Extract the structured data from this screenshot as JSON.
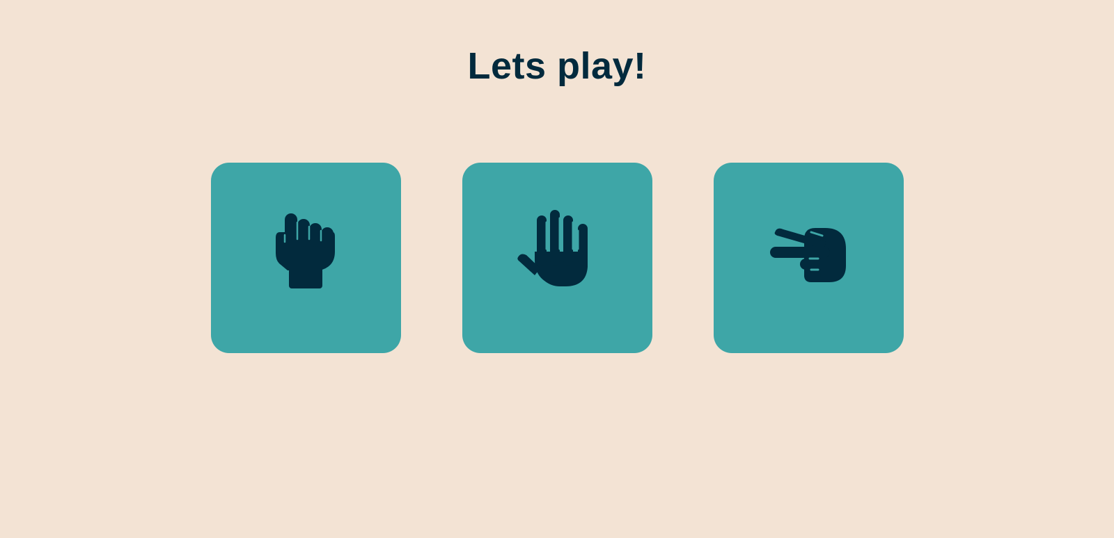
{
  "game": {
    "title": "Lets play!"
  },
  "choices": [
    {
      "id": "rock",
      "icon": "rock-fist-icon"
    },
    {
      "id": "paper",
      "icon": "paper-hand-icon"
    },
    {
      "id": "scissors",
      "icon": "scissors-hand-icon"
    }
  ],
  "colors": {
    "background": "#f3e3d4",
    "card": "#3ea6a7",
    "ink": "#022a3d"
  }
}
